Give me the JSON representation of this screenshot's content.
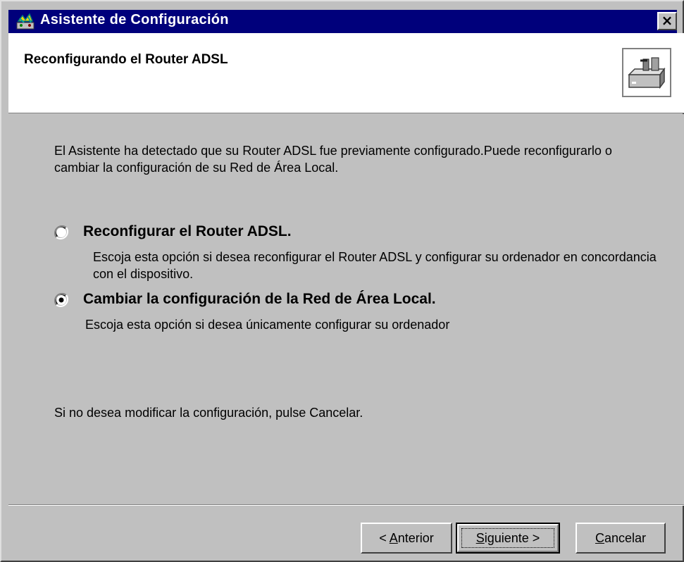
{
  "window": {
    "title": "Asistente de Configuración",
    "close_label": "×"
  },
  "header": {
    "title": "Reconfigurando el Router ADSL",
    "image_icon": "router-device-icon"
  },
  "body": {
    "intro": "El Asistente ha detectado que su Router ADSL fue previamente configurado.Puede reconfigurarlo o cambiar la configuración de su Red de Área Local.",
    "options": [
      {
        "label": "Reconfigurar el Router ADSL.",
        "description": "Escoja esta opción si desea reconfigurar el Router ADSL y configurar su ordenador en concordancia con el dispositivo.",
        "selected": false
      },
      {
        "label": "Cambiar la configuración de la Red de Área Local.",
        "description": "Escoja esta opción si desea únicamente configurar su ordenador",
        "selected": true
      }
    ],
    "footer_note": "Si no desea modificar la configuración, pulse Cancelar."
  },
  "buttons": {
    "back": {
      "prefix": "< ",
      "accel": "A",
      "rest": "nterior"
    },
    "next": {
      "prefix": "",
      "accel": "S",
      "rest": "iguiente >"
    },
    "cancel": {
      "prefix": "",
      "accel": "C",
      "rest": "ancelar"
    }
  },
  "colors": {
    "titlebar": "#00007b",
    "face": "#c0c0c0"
  }
}
